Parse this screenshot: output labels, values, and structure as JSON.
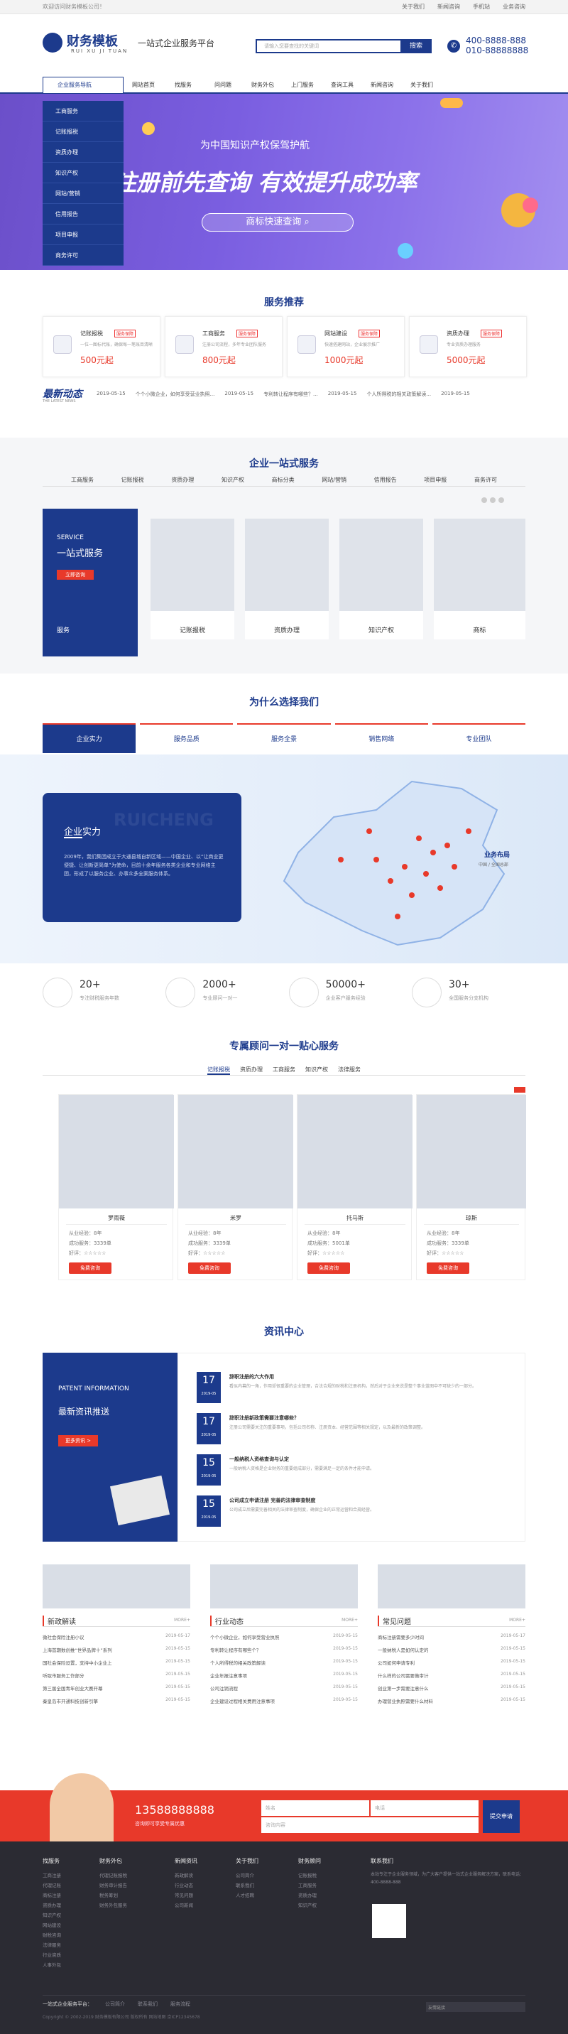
{
  "topbar": {
    "welcome": "欢迎访问财务模板公司！",
    "links": [
      "关于我们",
      "新闻咨询",
      "手机站",
      "业务咨询"
    ]
  },
  "header": {
    "brand": "财务模板",
    "brand_en": "RUI XU JI TUAN",
    "slogan": "一站式企业服务平台",
    "search_placeholder": "请输入您要查找的关键词",
    "search_button": "搜索",
    "phone1": "400-8888-888",
    "phone2": "010-88888888"
  },
  "nav": {
    "first": "企业服务导航",
    "items": [
      "网站首页",
      "找服务",
      "问问题",
      "财务外包",
      "上门服务",
      "查询工具",
      "新闻咨询",
      "关于我们"
    ]
  },
  "sidemenu": [
    "工商服务",
    "记账报税",
    "资质办理",
    "知识产权",
    "网站/营销",
    "信用报告",
    "项目申报",
    "商务许可"
  ],
  "banner": {
    "line1": "为中国知识产权保驾护航",
    "line2": "注册前先查询 有效提升成功率",
    "button": "商标快速查询"
  },
  "services": {
    "title": "服务推荐",
    "cards": [
      {
        "name": "记账报税",
        "tag": "服务保障",
        "desc": "一位一图标代账，确保每一笔账目清晰",
        "price": "500元起"
      },
      {
        "name": "工商服务",
        "tag": "服务保障",
        "desc": "注册公司流程，多年专业团队服务",
        "price": "800元起"
      },
      {
        "name": "网站建设",
        "tag": "服务保障",
        "desc": "快速搭建网站，企业展示推广",
        "price": "1000元起"
      },
      {
        "name": "资质办理",
        "tag": "服务保障",
        "desc": "专业资质办理服务",
        "price": "5000元起"
      }
    ]
  },
  "newsbar": {
    "logo": "最新动态",
    "sub": "THE LATEST NEWS",
    "items": [
      {
        "date": "2019-05-15",
        "title": "个个小微企业，如何享受营业执照..."
      },
      {
        "date": "2019-05-15",
        "title": "专利转让程序有哪些？..."
      },
      {
        "date": "2019-05-15",
        "title": "个人所得税的相关政策解读..."
      },
      {
        "date": "2019-05-15",
        "title": ""
      }
    ]
  },
  "onestop": {
    "title": "企业一站式服务",
    "tabs": [
      "工商服务",
      "记账报税",
      "资质办理",
      "知识产权",
      "商标分类",
      "网站/营销",
      "信用报告",
      "项目申报",
      "商务许可"
    ],
    "left_en": "SERVICE",
    "left_title": "一站式服务",
    "left_button": "立即咨询",
    "products": [
      "记账报税",
      "资质办理",
      "知识产权",
      "商标"
    ],
    "first_product": "服务"
  },
  "why": {
    "title": "为什么选择我们",
    "tabs": [
      "企业实力",
      "服务品质",
      "服务全景",
      "销售网络",
      "专业团队"
    ],
    "card_title": "企业实力",
    "card_text": "2009年，我们集团成立于大通县城自新区域——中国企业、以“让商业更便捷、让创新更简单”为使命，目前十余年服务各类企业和专业网络主团，形成了以服务企业、办事众多全案服务体系。",
    "watermark": "RUICHENG",
    "map_label": "业务布局",
    "map_sub": "中国 / 全国总部"
  },
  "stats": [
    {
      "num": "20+",
      "desc": "专注财税服务年数"
    },
    {
      "num": "2000+",
      "desc": "专业顾问一对一"
    },
    {
      "num": "50000+",
      "desc": "企业客户服务经验"
    },
    {
      "num": "30+",
      "desc": "全国服务分支机构"
    }
  ],
  "experts": {
    "title": "专属顾问一对一贴心服务",
    "tabs": [
      "记账报税",
      "资质办理",
      "工商服务",
      "知识产权",
      "法律服务"
    ],
    "list": [
      {
        "name": "罗雨薇",
        "years": "从业经验：8年",
        "count": "成功服务：3339单",
        "rate": "好评：☆☆☆☆☆",
        "btn": "免费咨询"
      },
      {
        "name": "米罗",
        "years": "从业经验：8年",
        "count": "成功服务：3339单",
        "rate": "好评：☆☆☆☆☆",
        "btn": "免费咨询"
      },
      {
        "name": "托马斯",
        "years": "从业经验：8年",
        "count": "成功服务：5001单",
        "rate": "好评：☆☆☆☆☆",
        "btn": "免费咨询"
      },
      {
        "name": "琼斯",
        "years": "从业经验：8年",
        "count": "成功服务：3339单",
        "rate": "好评：☆☆☆☆☆",
        "btn": "免费咨询"
      }
    ]
  },
  "newscenter": {
    "title": "资讯中心",
    "left_en": "PATENT INFORMATION",
    "left_title": "最新资讯推送",
    "left_button": "更多资讯 >",
    "rows": [
      {
        "day": "17",
        "month": "2019-05",
        "title": "辞职注册的六大作用",
        "excerpt": "看似内幕的一角，作用却很重要的企业管理，合法合规的财税和注册机构，然后对于企业来说是整个事业蓝图中不可缺少的一部分。"
      },
      {
        "day": "17",
        "month": "2019-05",
        "title": "辞职注册新政策需要注意哪些？",
        "excerpt": "注册公司需要关注的重要事项，包括公司名称、注册资本、经营范围等相关规定，以及最新的政策调整。"
      },
      {
        "day": "15",
        "month": "2019-05",
        "title": "一般纳税人资格查询与认定",
        "excerpt": "一般纳税人资格是企业财务的重要组成部分，需要满足一定的条件才能申请。"
      },
      {
        "day": "15",
        "month": "2019-05",
        "title": "公司成立申请注册 完善的法律审查制度",
        "excerpt": "公司成立后需要完善相关的法律审查制度，确保企业的正常运营和合规经营。"
      }
    ]
  },
  "columns": [
    {
      "title": "新政解读",
      "more": "MORE+",
      "items": [
        {
          "t": "微社会保险注册小议",
          "d": "2019-05-17"
        },
        {
          "t": "上海首期数创推“世界品牌十”系列",
          "d": "2019-05-15"
        },
        {
          "t": "国社会保险设置，支持中小企业上",
          "d": "2019-05-15"
        },
        {
          "t": "听取市服务工作部分",
          "d": "2019-05-15"
        },
        {
          "t": "第三届全国青年创业大赛开幕",
          "d": "2019-05-15"
        },
        {
          "t": "秦皇岛市开通科技创新引擎",
          "d": "2019-05-15"
        }
      ]
    },
    {
      "title": "行业动态",
      "more": "MORE+",
      "items": [
        {
          "t": "个个小微企业，如何享受营业执照",
          "d": "2019-05-15"
        },
        {
          "t": "专利转让程序有哪些个？",
          "d": "2019-05-15"
        },
        {
          "t": "个人所得税的相关政策解读",
          "d": "2019-05-15"
        },
        {
          "t": "企业年报注意事项",
          "d": "2019-05-15"
        },
        {
          "t": "公司注销流程",
          "d": "2019-05-15"
        },
        {
          "t": "企业建设过程相关费用注意事项",
          "d": "2019-05-15"
        }
      ]
    },
    {
      "title": "常见问题",
      "more": "MORE+",
      "items": [
        {
          "t": "商标注册需要多少时间",
          "d": "2019-05-17"
        },
        {
          "t": "一般纳税人是如何认定的",
          "d": "2019-05-15"
        },
        {
          "t": "公司如何申请专利",
          "d": "2019-05-15"
        },
        {
          "t": "什么样的公司需要做审计",
          "d": "2019-05-15"
        },
        {
          "t": "创业第一步需要注意什么",
          "d": "2019-05-15"
        },
        {
          "t": "办理营业执照需要什么材料",
          "d": "2019-05-15"
        }
      ]
    }
  ],
  "consult": {
    "phone": "13588888888",
    "desc": "咨询即可享受专属优惠",
    "f1": "姓名",
    "f2": "电话",
    "f3": "咨询内容",
    "submit": "提交申请"
  },
  "footer": {
    "cols": [
      {
        "h": "找服务",
        "items": [
          "工商注册",
          "代理记账",
          "商标注册",
          "资质办理",
          "知识产权",
          "网站建设",
          "财税咨询",
          "法律服务",
          "行业资质",
          "人事外包"
        ]
      },
      {
        "h": "财务外包",
        "items": [
          "代理记账报税",
          "财务审计报告",
          "税务筹划",
          "财务外包服务"
        ]
      },
      {
        "h": "新闻资讯",
        "items": [
          "新政解读",
          "行业动态",
          "常见问题",
          "公司新闻"
        ]
      },
      {
        "h": "关于我们",
        "items": [
          "公司简介",
          "联系我们",
          "人才招聘"
        ]
      },
      {
        "h": "财务顾问",
        "items": [
          "记账报税",
          "工商服务",
          "资质办理",
          "知识产权"
        ]
      }
    ],
    "contact_h": "联系我们",
    "contact_p": "本站专注于企业服务领域，为广大客户提供一站式企业服务解决方案，联系电话：400-8888-888",
    "links_label": "一站式企业服务平台：",
    "links": [
      "公司简介",
      "联系我们",
      "服务流程"
    ],
    "copyright": "Copyright © 2002-2019 财务模板有限公司 版权所有 网站地图 京ICP12345678",
    "select": "友情链接"
  },
  "colors": {
    "primary": "#1c3a8c",
    "accent": "#e8392a"
  }
}
